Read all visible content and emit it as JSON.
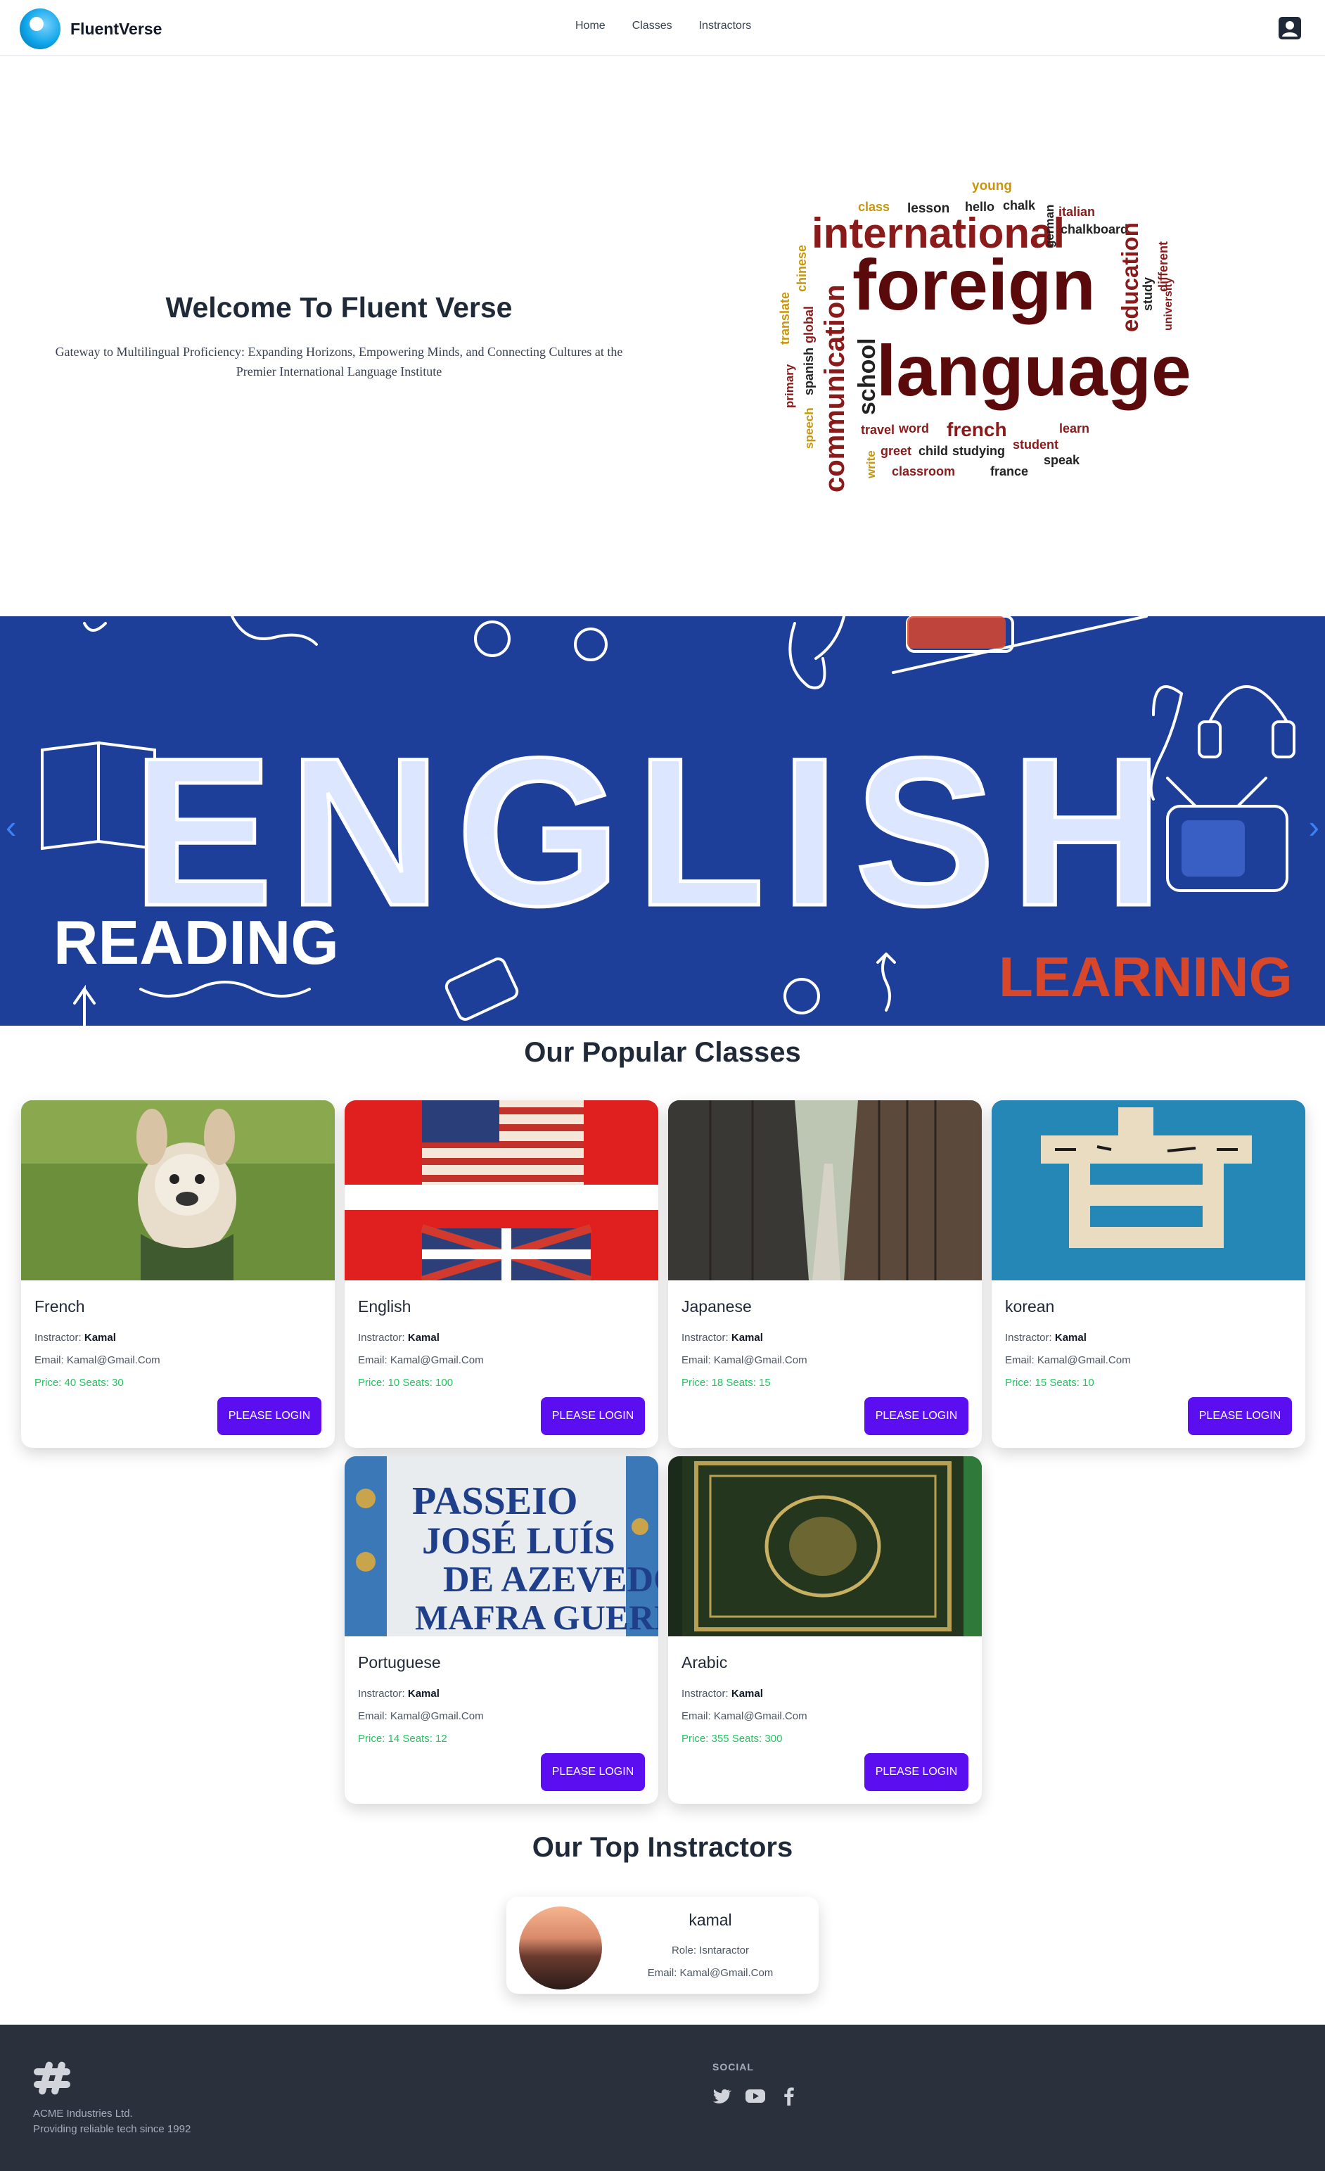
{
  "brand": {
    "name": "FluentVerse"
  },
  "nav": {
    "home": "Home",
    "classes": "Classes",
    "instructors": "Instractors"
  },
  "hero": {
    "title": "Welcome To Fluent Verse",
    "subtitle": "Gateway to Multilingual Proficiency: Expanding Horizons, Empowering Minds, and Connecting Cultures at the Premier International Language Institute",
    "wordcloud": [
      "young",
      "class",
      "lesson",
      "hello",
      "chalk",
      "italian",
      "international",
      "german",
      "chalkboard",
      "chinese",
      "foreign",
      "education",
      "different",
      "study",
      "university",
      "translate",
      "global",
      "communication",
      "school",
      "language",
      "primary",
      "spanish",
      "speech",
      "travel",
      "word",
      "french",
      "learn",
      "student",
      "write",
      "greet",
      "child",
      "studying",
      "speak",
      "classroom",
      "france"
    ]
  },
  "banner": {
    "title": "ENGLISH",
    "left_caption": "READING",
    "right_caption": "LEARNING"
  },
  "popular": {
    "title": "Our Popular Classes",
    "instructor_label": "Instractor: ",
    "email_label": "Email: ",
    "button_label": "PLEASE LOGIN",
    "classes": [
      {
        "name": "French",
        "instructor": "Kamal",
        "email": "Kamal@Gmail.Com",
        "price_seats": "Price: 40 Seats: 30"
      },
      {
        "name": "English",
        "instructor": "Kamal",
        "email": "Kamal@Gmail.Com",
        "price_seats": "Price: 10 Seats: 100"
      },
      {
        "name": "Japanese",
        "instructor": "Kamal",
        "email": "Kamal@Gmail.Com",
        "price_seats": "Price: 18 Seats: 15"
      },
      {
        "name": "korean",
        "instructor": "Kamal",
        "email": "Kamal@Gmail.Com",
        "price_seats": "Price: 15 Seats: 10"
      },
      {
        "name": "Portuguese",
        "instructor": "Kamal",
        "email": "Kamal@Gmail.Com",
        "price_seats": "Price: 14 Seats: 12"
      },
      {
        "name": "Arabic",
        "instructor": "Kamal",
        "email": "Kamal@Gmail.Com",
        "price_seats": "Price: 355 Seats: 300"
      }
    ]
  },
  "instructors": {
    "title": "Our Top Instractors",
    "items": [
      {
        "name": "kamal",
        "role": "Role: Isntaractor",
        "email": "Email: Kamal@Gmail.Com"
      }
    ]
  },
  "footer": {
    "company": "ACME Industries Ltd.",
    "tagline": "Providing reliable tech since 1992",
    "social_title": "SOCIAL"
  },
  "colors": {
    "button": "#5b0ef0",
    "footer_bg": "#2a303c",
    "banner_bg": "#1d3f9a",
    "price_text": "#22c55e"
  }
}
